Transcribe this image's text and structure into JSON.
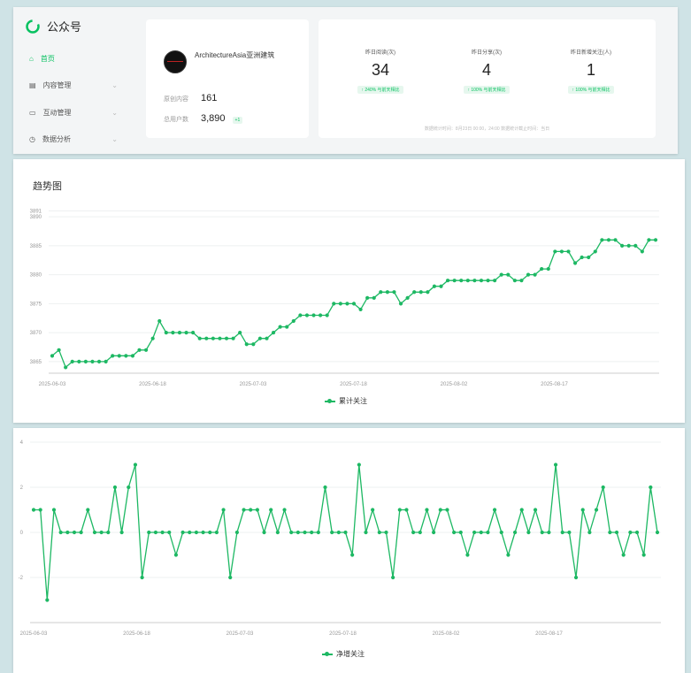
{
  "sidebar": {
    "brand": "公众号",
    "items": [
      {
        "label": "首页",
        "icon": "home-icon",
        "active": true
      },
      {
        "label": "内容管理",
        "icon": "document-icon"
      },
      {
        "label": "互动管理",
        "icon": "chat-icon"
      },
      {
        "label": "数据分析",
        "icon": "clock-icon"
      }
    ]
  },
  "account": {
    "name": "ArchitectureAsia亚洲建筑",
    "content_label": "原创内容",
    "content_value": "161",
    "users_label": "总用户数",
    "users_value": "3,890",
    "users_badge": "+1"
  },
  "stats": {
    "items": [
      {
        "label": "昨日阅读(次)",
        "value": "34",
        "change": "↑ 240% 与前天相比"
      },
      {
        "label": "昨日分享(次)",
        "value": "4",
        "change": "↑ 100% 与前天相比"
      },
      {
        "label": "昨日新增关注(人)",
        "value": "1",
        "change": "↑ 100% 与前天相比"
      }
    ],
    "note": "数据统计时间：8月23日 00:00，24:00 数据统计截止时间：当日"
  },
  "colors": {
    "accent": "#07c160",
    "line": "#1db863"
  },
  "chart_data": [
    {
      "type": "line",
      "title": "趋势图",
      "xlabel": "",
      "ylabel": "",
      "ylim": [
        3863,
        3892
      ],
      "yticks": [
        3865,
        3870,
        3875,
        3880,
        3885,
        3890,
        3891
      ],
      "xtick_labels": [
        "2025-06-03",
        "2025-06-18",
        "2025-07-03",
        "2025-07-18",
        "2025-08-02",
        "2025-08-17"
      ],
      "grid": true,
      "legend": "bottom-center",
      "series": [
        {
          "name": "累计关注",
          "values": [
            3866,
            3867,
            3864,
            3865,
            3865,
            3865,
            3865,
            3865,
            3865,
            3866,
            3866,
            3866,
            3866,
            3867,
            3867,
            3869,
            3872,
            3870,
            3870,
            3870,
            3870,
            3870,
            3869,
            3869,
            3869,
            3869,
            3869,
            3869,
            3870,
            3868,
            3868,
            3869,
            3869,
            3870,
            3871,
            3871,
            3872,
            3873,
            3873,
            3873,
            3873,
            3873,
            3875,
            3875,
            3875,
            3875,
            3874,
            3876,
            3876,
            3877,
            3877,
            3877,
            3875,
            3876,
            3877,
            3877,
            3877,
            3878,
            3878,
            3879,
            3879,
            3879,
            3879,
            3879,
            3879,
            3879,
            3879,
            3880,
            3880,
            3879,
            3879,
            3880,
            3880,
            3881,
            3881,
            3884,
            3884,
            3884,
            3882,
            3883,
            3883,
            3884,
            3886,
            3886,
            3886,
            3885,
            3885,
            3885,
            3884,
            3886,
            3886
          ]
        }
      ]
    },
    {
      "type": "line",
      "title": "",
      "xlabel": "",
      "ylabel": "",
      "ylim": [
        -4,
        4
      ],
      "yticks": [
        -2,
        0,
        2,
        4
      ],
      "xtick_labels": [
        "2025-06-03",
        "2025-06-18",
        "2025-07-03",
        "2025-07-18",
        "2025-08-02",
        "2025-08-17"
      ],
      "grid": true,
      "legend": "bottom-center",
      "series": [
        {
          "name": "净增关注",
          "values": [
            1,
            1,
            -3,
            1,
            0,
            0,
            0,
            0,
            1,
            0,
            0,
            0,
            2,
            0,
            2,
            3,
            -2,
            0,
            0,
            0,
            0,
            -1,
            0,
            0,
            0,
            0,
            0,
            0,
            1,
            -2,
            0,
            1,
            1,
            1,
            0,
            1,
            0,
            1,
            0,
            0,
            0,
            0,
            0,
            2,
            0,
            0,
            0,
            -1,
            3,
            0,
            1,
            0,
            0,
            -2,
            1,
            1,
            0,
            0,
            1,
            0,
            1,
            1,
            0,
            0,
            -1,
            0,
            0,
            0,
            1,
            0,
            -1,
            0,
            1,
            0,
            1,
            0,
            0,
            3,
            0,
            0,
            -2,
            1,
            0,
            1,
            2,
            0,
            0,
            -1,
            0,
            0,
            -1,
            2,
            0
          ]
        }
      ]
    }
  ]
}
